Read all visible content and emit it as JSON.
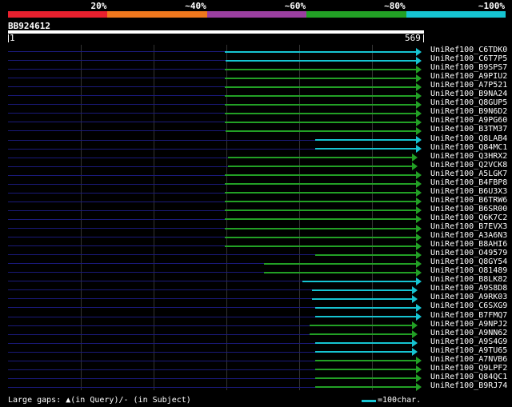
{
  "legend": {
    "colors": [
      "#e8202e",
      "#f0781e",
      "#9b3fa0",
      "#22a025",
      "#16c4d2"
    ],
    "labels": [
      "20%",
      "~40%",
      "~60%",
      "~80%",
      "~100%"
    ]
  },
  "query": {
    "name": "BB924612",
    "start": "1",
    "end": "569"
  },
  "hits": [
    {
      "id": "UniRef100_C6TDK0",
      "start": 281,
      "end": 520,
      "color": "#16c4d2"
    },
    {
      "id": "UniRef100_C6T7P5",
      "start": 282,
      "end": 520,
      "color": "#16c4d2"
    },
    {
      "id": "UniRef100_B9SPS7",
      "start": 281,
      "end": 520,
      "color": "#22a025"
    },
    {
      "id": "UniRef100_A9PIU2",
      "start": 281,
      "end": 520,
      "color": "#22a025"
    },
    {
      "id": "UniRef100_A7P521",
      "start": 281,
      "end": 520,
      "color": "#22a025"
    },
    {
      "id": "UniRef100_B9NA24",
      "start": 281,
      "end": 520,
      "color": "#22a025"
    },
    {
      "id": "UniRef100_Q8GUP5",
      "start": 281,
      "end": 520,
      "color": "#22a025"
    },
    {
      "id": "UniRef100_B9N6D2",
      "start": 281,
      "end": 520,
      "color": "#22a025"
    },
    {
      "id": "UniRef100_A9PG60",
      "start": 281,
      "end": 520,
      "color": "#22a025"
    },
    {
      "id": "UniRef100_B3TM37",
      "start": 282,
      "end": 520,
      "color": "#22a025"
    },
    {
      "id": "UniRef100_Q8LAB4",
      "start": 394,
      "end": 520,
      "color": "#16c4d2"
    },
    {
      "id": "UniRef100_Q84MC1",
      "start": 394,
      "end": 520,
      "color": "#16c4d2"
    },
    {
      "id": "UniRef100_Q3HRX2",
      "start": 285,
      "end": 515,
      "color": "#22a025"
    },
    {
      "id": "UniRef100_Q2VCK8",
      "start": 285,
      "end": 515,
      "color": "#22a025"
    },
    {
      "id": "UniRef100_A5LGK7",
      "start": 281,
      "end": 520,
      "color": "#22a025"
    },
    {
      "id": "UniRef100_B4FBP8",
      "start": 281,
      "end": 520,
      "color": "#22a025"
    },
    {
      "id": "UniRef100_B6U3X3",
      "start": 281,
      "end": 520,
      "color": "#22a025"
    },
    {
      "id": "UniRef100_B6TRW6",
      "start": 281,
      "end": 520,
      "color": "#22a025"
    },
    {
      "id": "UniRef100_B6SR00",
      "start": 281,
      "end": 520,
      "color": "#22a025"
    },
    {
      "id": "UniRef100_Q6K7C2",
      "start": 281,
      "end": 520,
      "color": "#22a025"
    },
    {
      "id": "UniRef100_B7EVX3",
      "start": 281,
      "end": 520,
      "color": "#22a025"
    },
    {
      "id": "UniRef100_A3A6N3",
      "start": 281,
      "end": 520,
      "color": "#22a025"
    },
    {
      "id": "UniRef100_B8AHI6",
      "start": 281,
      "end": 520,
      "color": "#22a025"
    },
    {
      "id": "UniRef100_O49579",
      "start": 394,
      "end": 520,
      "color": "#22a025"
    },
    {
      "id": "UniRef100_Q8GY54",
      "start": 330,
      "end": 520,
      "color": "#22a025"
    },
    {
      "id": "UniRef100_O81489",
      "start": 330,
      "end": 520,
      "color": "#22a025"
    },
    {
      "id": "UniRef100_B8LK82",
      "start": 378,
      "end": 520,
      "color": "#16c4d2"
    },
    {
      "id": "UniRef100_A9S8D8",
      "start": 390,
      "end": 515,
      "color": "#16c4d2"
    },
    {
      "id": "UniRef100_A9RK03",
      "start": 390,
      "end": 515,
      "color": "#16c4d2"
    },
    {
      "id": "UniRef100_C6SXG9",
      "start": 394,
      "end": 520,
      "color": "#16c4d2"
    },
    {
      "id": "UniRef100_B7FMQ7",
      "start": 394,
      "end": 520,
      "color": "#16c4d2"
    },
    {
      "id": "UniRef100_A9NPJ2",
      "start": 387,
      "end": 515,
      "color": "#22a025"
    },
    {
      "id": "UniRef100_A9NN62",
      "start": 387,
      "end": 515,
      "color": "#22a025"
    },
    {
      "id": "UniRef100_A9S4G9",
      "start": 394,
      "end": 515,
      "color": "#16c4d2"
    },
    {
      "id": "UniRef100_A9TU65",
      "start": 394,
      "end": 515,
      "color": "#16c4d2"
    },
    {
      "id": "UniRef100_A7NVB6",
      "start": 394,
      "end": 520,
      "color": "#22a025"
    },
    {
      "id": "UniRef100_Q9LPF2",
      "start": 394,
      "end": 520,
      "color": "#22a025"
    },
    {
      "id": "UniRef100_Q84QC1",
      "start": 394,
      "end": 520,
      "color": "#22a025"
    },
    {
      "id": "UniRef100_B9RJ74",
      "start": 394,
      "end": 520,
      "color": "#22a025"
    }
  ],
  "footer": {
    "gaps": "Large gaps: ▲(in Query)/- (in Subject)",
    "scale": "=100char."
  }
}
